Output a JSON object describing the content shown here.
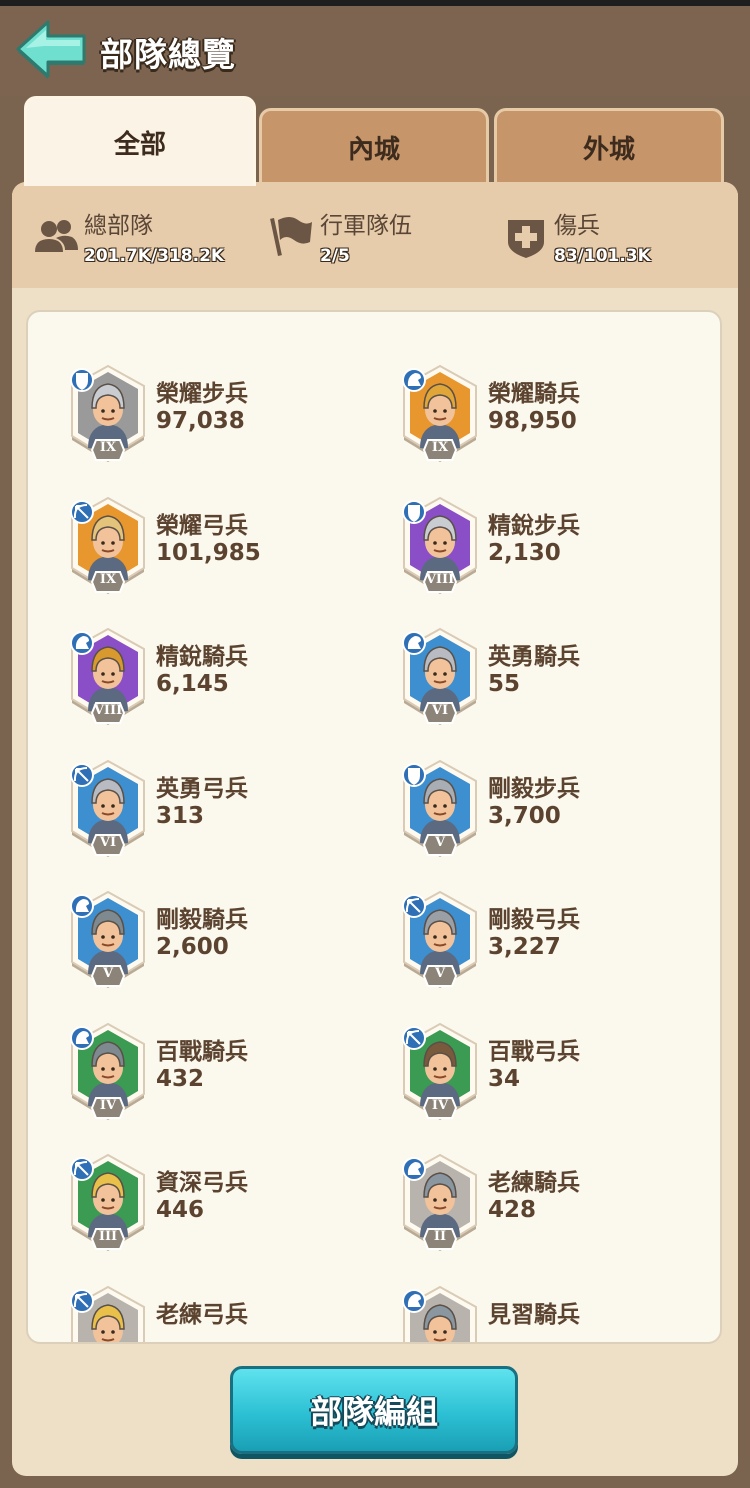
{
  "header": {
    "title": "部隊總覽"
  },
  "tabs": [
    {
      "label": "全部",
      "active": true
    },
    {
      "label": "內城",
      "active": false
    },
    {
      "label": "外城",
      "active": false
    }
  ],
  "stats": {
    "total": {
      "label": "總部隊",
      "value": "201.7K/318.2K",
      "icon": "troops-icon"
    },
    "march": {
      "label": "行軍隊伍",
      "value": "2/5",
      "icon": "flag-icon"
    },
    "wounded": {
      "label": "傷兵",
      "value": "83/101.3K",
      "icon": "medical-cross-icon"
    }
  },
  "troops": [
    {
      "name": "榮耀步兵",
      "count": "97,038",
      "tier": "IX",
      "type": "infantry",
      "bg": "#9a9a9a",
      "helmet": "#c9cdd2"
    },
    {
      "name": "榮耀騎兵",
      "count": "98,950",
      "tier": "IX",
      "type": "cavalry",
      "bg": "#e8962e",
      "helmet": "#e0a637"
    },
    {
      "name": "榮耀弓兵",
      "count": "101,985",
      "tier": "IX",
      "type": "archer",
      "bg": "#e8962e",
      "helmet": "#e4c37a"
    },
    {
      "name": "精銳步兵",
      "count": "2,130",
      "tier": "VIII",
      "type": "infantry",
      "bg": "#8a4fc7",
      "helmet": "#c9cdd2"
    },
    {
      "name": "精銳騎兵",
      "count": "6,145",
      "tier": "VIII",
      "type": "cavalry",
      "bg": "#8a4fc7",
      "helmet": "#d89a2e"
    },
    {
      "name": "英勇騎兵",
      "count": "55",
      "tier": "VI",
      "type": "cavalry",
      "bg": "#3d8fd0",
      "helmet": "#b8bcc2"
    },
    {
      "name": "英勇弓兵",
      "count": "313",
      "tier": "VI",
      "type": "archer",
      "bg": "#3d8fd0",
      "helmet": "#b8bcc2"
    },
    {
      "name": "剛毅步兵",
      "count": "3,700",
      "tier": "V",
      "type": "infantry",
      "bg": "#3d8fd0",
      "helmet": "#a9adb4"
    },
    {
      "name": "剛毅騎兵",
      "count": "2,600",
      "tier": "V",
      "type": "cavalry",
      "bg": "#3d8fd0",
      "helmet": "#7e8a8f"
    },
    {
      "name": "剛毅弓兵",
      "count": "3,227",
      "tier": "V",
      "type": "archer",
      "bg": "#3d8fd0",
      "helmet": "#9b9fa6"
    },
    {
      "name": "百戰騎兵",
      "count": "432",
      "tier": "IV",
      "type": "cavalry",
      "bg": "#3c9b52",
      "helmet": "#7e8a8f"
    },
    {
      "name": "百戰弓兵",
      "count": "34",
      "tier": "IV",
      "type": "archer",
      "bg": "#3c9b52",
      "helmet": "#7a5a3c"
    },
    {
      "name": "資深弓兵",
      "count": "446",
      "tier": "III",
      "type": "archer",
      "bg": "#3c9b52",
      "helmet": "#e8c04a"
    },
    {
      "name": "老練騎兵",
      "count": "428",
      "tier": "II",
      "type": "cavalry",
      "bg": "#b8b4ad",
      "helmet": "#8a96a0"
    },
    {
      "name": "老練弓兵",
      "count": "",
      "tier": "",
      "type": "archer",
      "bg": "#b8b4ad",
      "helmet": "#e8c04a"
    },
    {
      "name": "見習騎兵",
      "count": "",
      "tier": "",
      "type": "cavalry",
      "bg": "#b8b4ad",
      "helmet": "#8a96a0"
    }
  ],
  "footer": {
    "button_label": "部隊編組"
  }
}
